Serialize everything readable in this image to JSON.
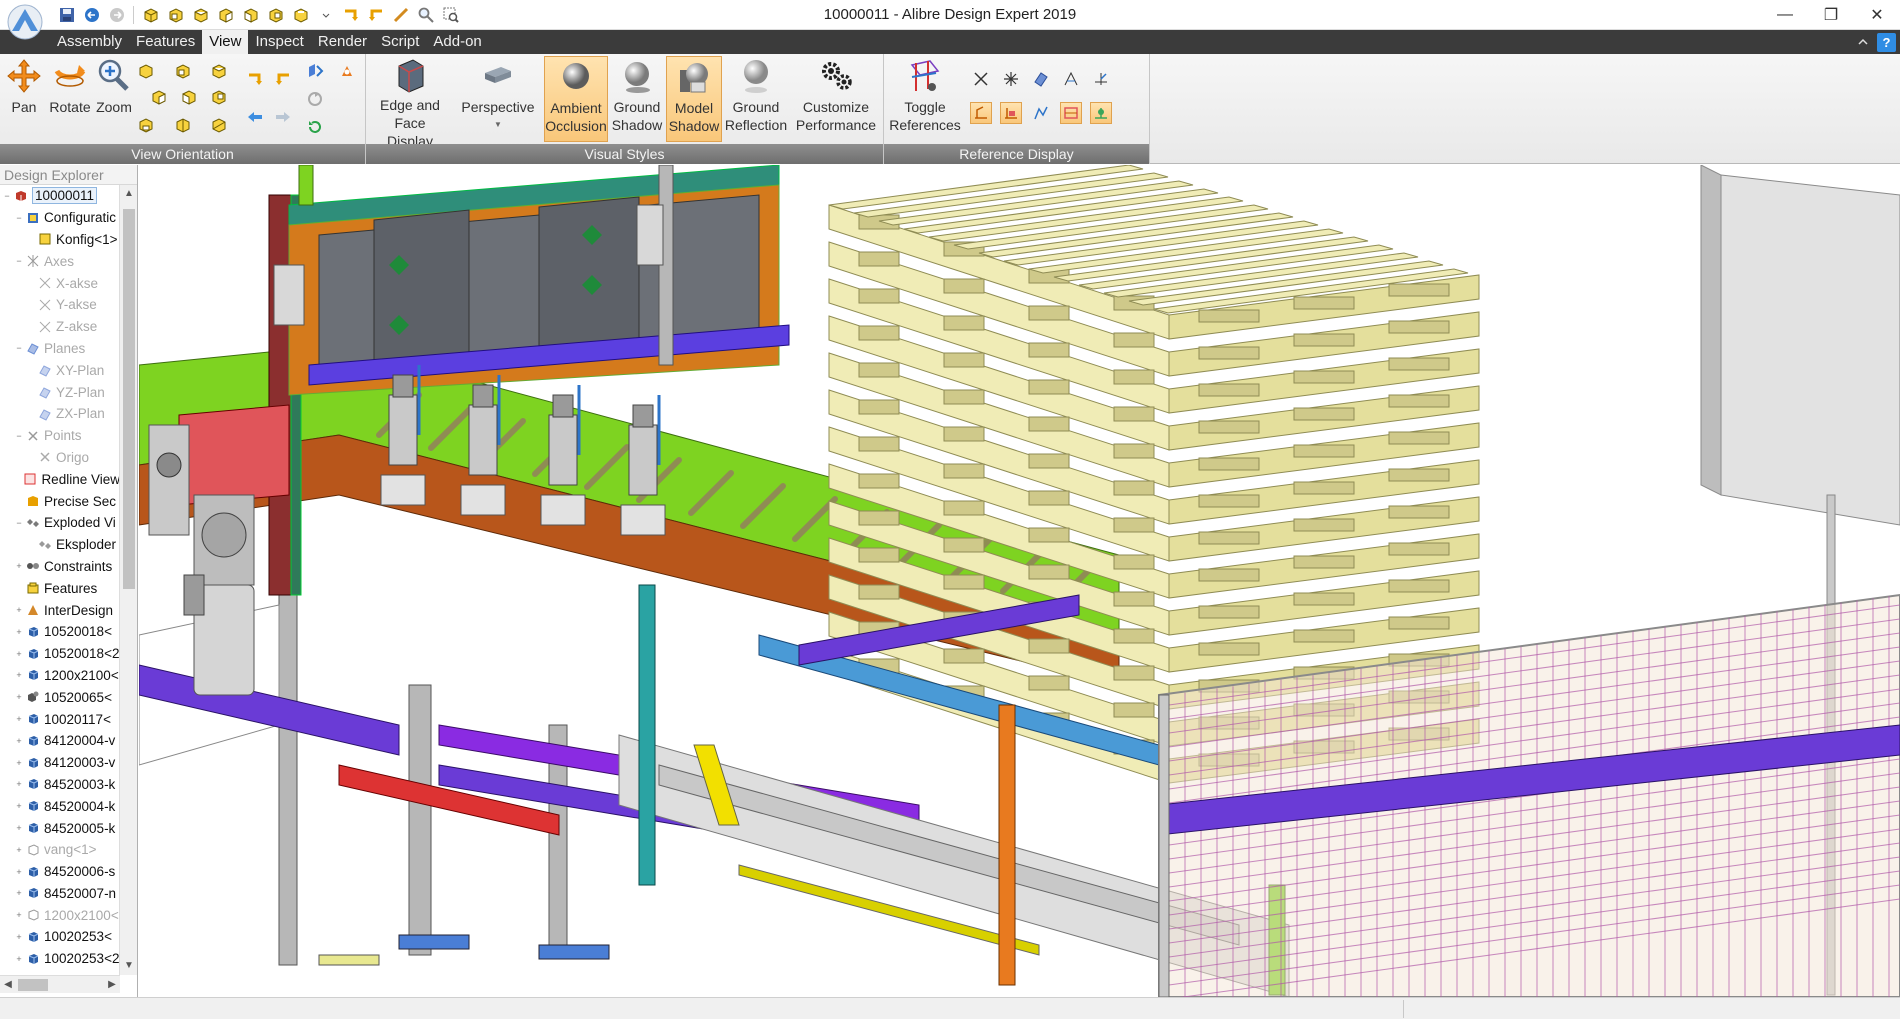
{
  "window": {
    "title": "10000011 - Alibre Design Expert 2019",
    "minimize": "—",
    "restore": "❐",
    "close": "✕"
  },
  "menu": {
    "items": [
      "Assembly",
      "Features",
      "View",
      "Inspect",
      "Render",
      "Script",
      "Add-on"
    ],
    "active": "View",
    "collapse_icon": "chevron-up-icon",
    "help_label": "?"
  },
  "ribbon": {
    "view_orientation": {
      "caption": "View Orientation",
      "pan": "Pan",
      "rotate": "Rotate",
      "zoom": "Zoom"
    },
    "visual_styles": {
      "caption": "Visual Styles",
      "edge_face_1": "Edge and",
      "edge_face_2": "Face Display",
      "perspective": "Perspective",
      "ambient_1": "Ambient",
      "ambient_2": "Occlusion",
      "ground_shadow_1": "Ground",
      "ground_shadow_2": "Shadow",
      "model_shadow_1": "Model",
      "model_shadow_2": "Shadow",
      "ground_reflection_1": "Ground",
      "ground_reflection_2": "Reflection",
      "customize_1": "Customize",
      "customize_2": "Performance"
    },
    "reference_display": {
      "caption": "Reference Display",
      "toggle_1": "Toggle",
      "toggle_2": "References"
    },
    "colors": {
      "active_bg": "#f9c77a",
      "caption_bg": "#7a7a7a"
    }
  },
  "explorer": {
    "title": "Design Explorer",
    "items": [
      {
        "label": "10000011",
        "icon": "assembly-icon",
        "dim": false,
        "indent": 0,
        "exp": "−"
      },
      {
        "label": "Configuratic",
        "icon": "config-icon",
        "dim": false,
        "indent": 1,
        "exp": "−"
      },
      {
        "label": "Konfig<1>",
        "icon": "config-item-icon",
        "dim": false,
        "indent": 2,
        "exp": ""
      },
      {
        "label": "Axes",
        "icon": "axes-icon",
        "dim": true,
        "indent": 1,
        "exp": "−"
      },
      {
        "label": "X-akse",
        "icon": "axis-icon",
        "dim": true,
        "indent": 2,
        "exp": ""
      },
      {
        "label": "Y-akse",
        "icon": "axis-icon",
        "dim": true,
        "indent": 2,
        "exp": ""
      },
      {
        "label": "Z-akse",
        "icon": "axis-icon",
        "dim": true,
        "indent": 2,
        "exp": ""
      },
      {
        "label": "Planes",
        "icon": "planes-icon",
        "dim": true,
        "indent": 1,
        "exp": "−"
      },
      {
        "label": "XY-Plan",
        "icon": "plane-icon",
        "dim": true,
        "indent": 2,
        "exp": ""
      },
      {
        "label": "YZ-Plan",
        "icon": "plane-icon",
        "dim": true,
        "indent": 2,
        "exp": ""
      },
      {
        "label": "ZX-Plan",
        "icon": "plane-icon",
        "dim": true,
        "indent": 2,
        "exp": ""
      },
      {
        "label": "Points",
        "icon": "points-icon",
        "dim": true,
        "indent": 1,
        "exp": "−"
      },
      {
        "label": "Origo",
        "icon": "point-icon",
        "dim": true,
        "indent": 2,
        "exp": ""
      },
      {
        "label": "Redline View",
        "icon": "redline-icon",
        "dim": false,
        "indent": 1,
        "exp": ""
      },
      {
        "label": "Precise Sec",
        "icon": "section-icon",
        "dim": false,
        "indent": 1,
        "exp": ""
      },
      {
        "label": "Exploded Vi",
        "icon": "exploded-icon",
        "dim": false,
        "indent": 1,
        "exp": "−"
      },
      {
        "label": "Eksploder",
        "icon": "exploded-item-icon",
        "dim": false,
        "indent": 2,
        "exp": ""
      },
      {
        "label": "Constraints",
        "icon": "constraints-icon",
        "dim": false,
        "indent": 1,
        "exp": "+"
      },
      {
        "label": "Features",
        "icon": "features-icon",
        "dim": false,
        "indent": 1,
        "exp": ""
      },
      {
        "label": "InterDesign",
        "icon": "interdesign-icon",
        "dim": false,
        "indent": 1,
        "exp": "+"
      },
      {
        "label": "10520018<",
        "icon": "part-icon",
        "dim": false,
        "indent": 1,
        "exp": "+"
      },
      {
        "label": "10520018<2",
        "icon": "part-icon",
        "dim": false,
        "indent": 1,
        "exp": "+"
      },
      {
        "label": "1200x2100<",
        "icon": "part-icon",
        "dim": false,
        "indent": 1,
        "exp": "+"
      },
      {
        "label": "10520065<",
        "icon": "subassembly-icon",
        "dim": false,
        "indent": 1,
        "exp": "+"
      },
      {
        "label": "10020117<",
        "icon": "part-icon",
        "dim": false,
        "indent": 1,
        "exp": "+"
      },
      {
        "label": "84120004-v",
        "icon": "part-icon",
        "dim": false,
        "indent": 1,
        "exp": "+"
      },
      {
        "label": "84120003-v",
        "icon": "part-icon",
        "dim": false,
        "indent": 1,
        "exp": "+"
      },
      {
        "label": "84520003-k",
        "icon": "part-icon",
        "dim": false,
        "indent": 1,
        "exp": "+"
      },
      {
        "label": "84520004-k",
        "icon": "part-icon",
        "dim": false,
        "indent": 1,
        "exp": "+"
      },
      {
        "label": "84520005-k",
        "icon": "part-icon",
        "dim": false,
        "indent": 1,
        "exp": "+"
      },
      {
        "label": "vang<1>",
        "icon": "suppressed-part-icon",
        "dim": true,
        "indent": 1,
        "exp": "+"
      },
      {
        "label": "84520006-s",
        "icon": "part-icon",
        "dim": false,
        "indent": 1,
        "exp": "+"
      },
      {
        "label": "84520007-n",
        "icon": "part-icon",
        "dim": false,
        "indent": 1,
        "exp": "+"
      },
      {
        "label": "1200x2100<",
        "icon": "suppressed-part-icon",
        "dim": true,
        "indent": 1,
        "exp": "+"
      },
      {
        "label": "10020253<",
        "icon": "part-icon",
        "dim": false,
        "indent": 1,
        "exp": "+"
      },
      {
        "label": "10020253<2",
        "icon": "part-icon",
        "dim": false,
        "indent": 1,
        "exp": "+"
      }
    ]
  },
  "viewport": {
    "model": "conveyor-palletizer-assembly",
    "colors": {
      "pallet_wood": "#f0ecb6",
      "pallet_edge": "#8f8c54",
      "conveyor_orange": "#b8561b",
      "frame_green": "#7ed321",
      "accent_purple": "#6a3bd6",
      "accent_red": "#e0555a",
      "steel_gray": "#a9a9a9"
    }
  }
}
